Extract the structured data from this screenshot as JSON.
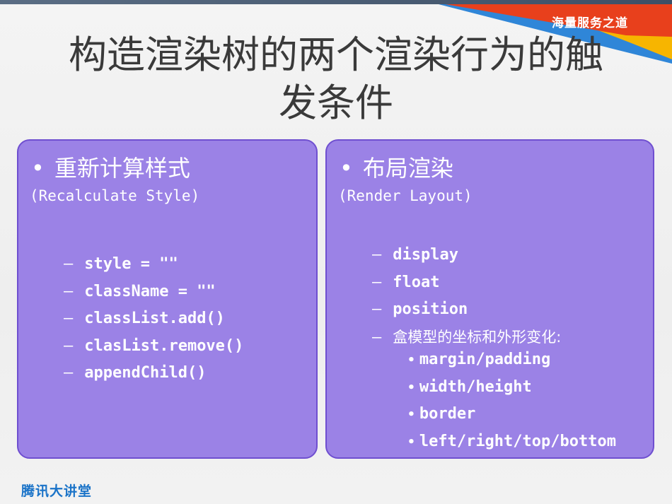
{
  "brand": {
    "banner_text": "海量服务之道"
  },
  "title": {
    "line1": "构造渲染树的两个渲染行为的触",
    "line2": "发条件"
  },
  "left_card": {
    "heading": "重新计算样式",
    "subheading": "(Recalculate Style)",
    "items": [
      "style = \"\"",
      "className = \"\"",
      "classList.add()",
      "clasList.remove()",
      "appendChild()"
    ]
  },
  "right_card": {
    "heading": "布局渲染",
    "subheading": "(Render Layout)",
    "items": [
      "display",
      "float",
      "position",
      "盒模型的坐标和外形变化:"
    ],
    "sub_items": [
      "margin/padding",
      "width/height",
      "border",
      "left/right/top/bottom"
    ]
  },
  "glyphs": {
    "bullet": "•",
    "dash": "–",
    "sub_bullet": "•"
  },
  "footer": {
    "logo_text": "腾讯大讲堂"
  },
  "colors": {
    "card_fill": "#9b82e6",
    "card_border": "#6f4fd0",
    "title_text": "#3a3a3a",
    "banner_red": "#e8401c",
    "banner_yellow": "#f7b500",
    "footer_blue": "#1a73c8"
  }
}
